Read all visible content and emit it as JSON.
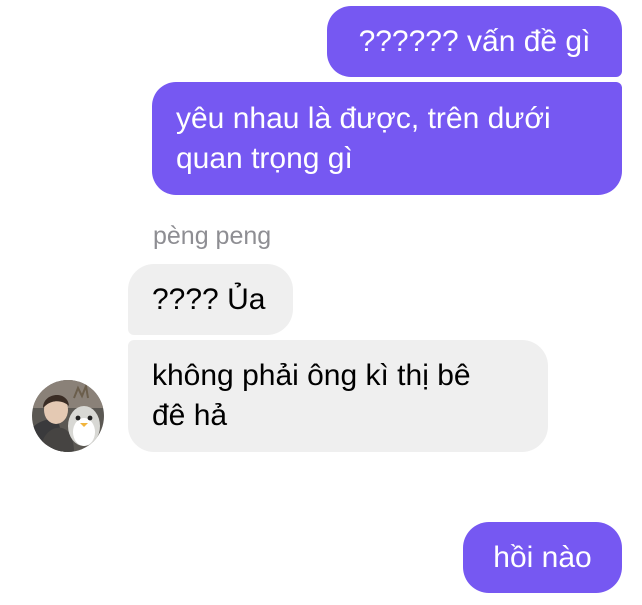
{
  "conversation": {
    "messages": [
      {
        "direction": "outgoing",
        "text": "?????? vấn đề gì"
      },
      {
        "direction": "outgoing",
        "text": "yêu nhau là được, trên dưới\nquan trọng gì"
      },
      {
        "direction": "incoming",
        "text": "???? Ủa"
      },
      {
        "direction": "incoming",
        "text": "không phải ông kì thị bê\nđê hả"
      },
      {
        "direction": "outgoing",
        "text": "hồi nào"
      }
    ],
    "incoming_sender": "pèng peng"
  },
  "colors": {
    "outgoing_bubble": "#7658f2",
    "incoming_bubble": "#efefef",
    "sender_name": "#8e8e93"
  },
  "icons": {
    "avatar": "sender-avatar-photo"
  }
}
